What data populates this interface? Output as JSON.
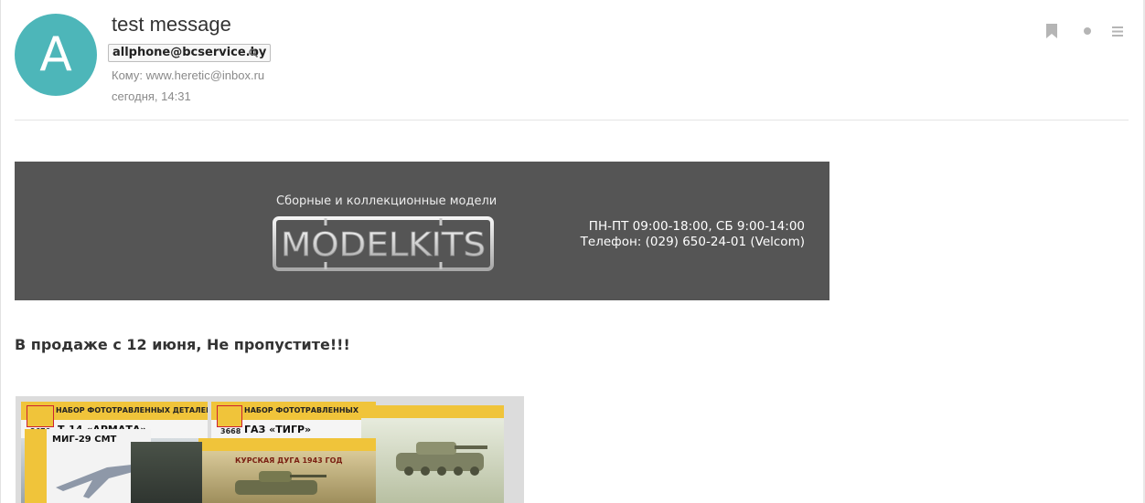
{
  "message": {
    "subject": "test message",
    "avatar_letter": "A",
    "sender": "allphone@bcservice.by",
    "to": "Кому: www.heretic@inbox.ru",
    "date": "сегодня, 14:31"
  },
  "colors": {
    "avatar": "#4db6b9",
    "banner": "#555555",
    "icons": "#b5b5b5"
  },
  "header_actions": [
    "bookmark-icon",
    "dot-icon",
    "menu-icon"
  ],
  "banner": {
    "tagline": "Сборные и коллекционные модели",
    "logo_text": "MODELKITS",
    "hours": "ПН-ПТ 09:00-18:00, СБ 9:00-14:00",
    "phone": "Телефон: (029) 650-24-01 (Velcom)"
  },
  "body": {
    "headline": "В продаже с 12 июня, Не пропустите!!!"
  },
  "products": [
    {
      "code": "3670",
      "kit_label": "НАБОР ФОТОТРАВЛЕННЫХ ДЕТАЛЕЙ",
      "title": "Т-14 «АРМАТА»"
    },
    {
      "code": "3668",
      "kit_label": "НАБОР ФОТОТРАВЛЕННЫХ ДЕТАЛЕЙ",
      "title": "ГАЗ «ТИГР»"
    },
    {
      "title": "МИГ-29 СМТ"
    },
    {
      "title": "КУРСКАЯ ДУГА 1943 ГОД"
    }
  ]
}
